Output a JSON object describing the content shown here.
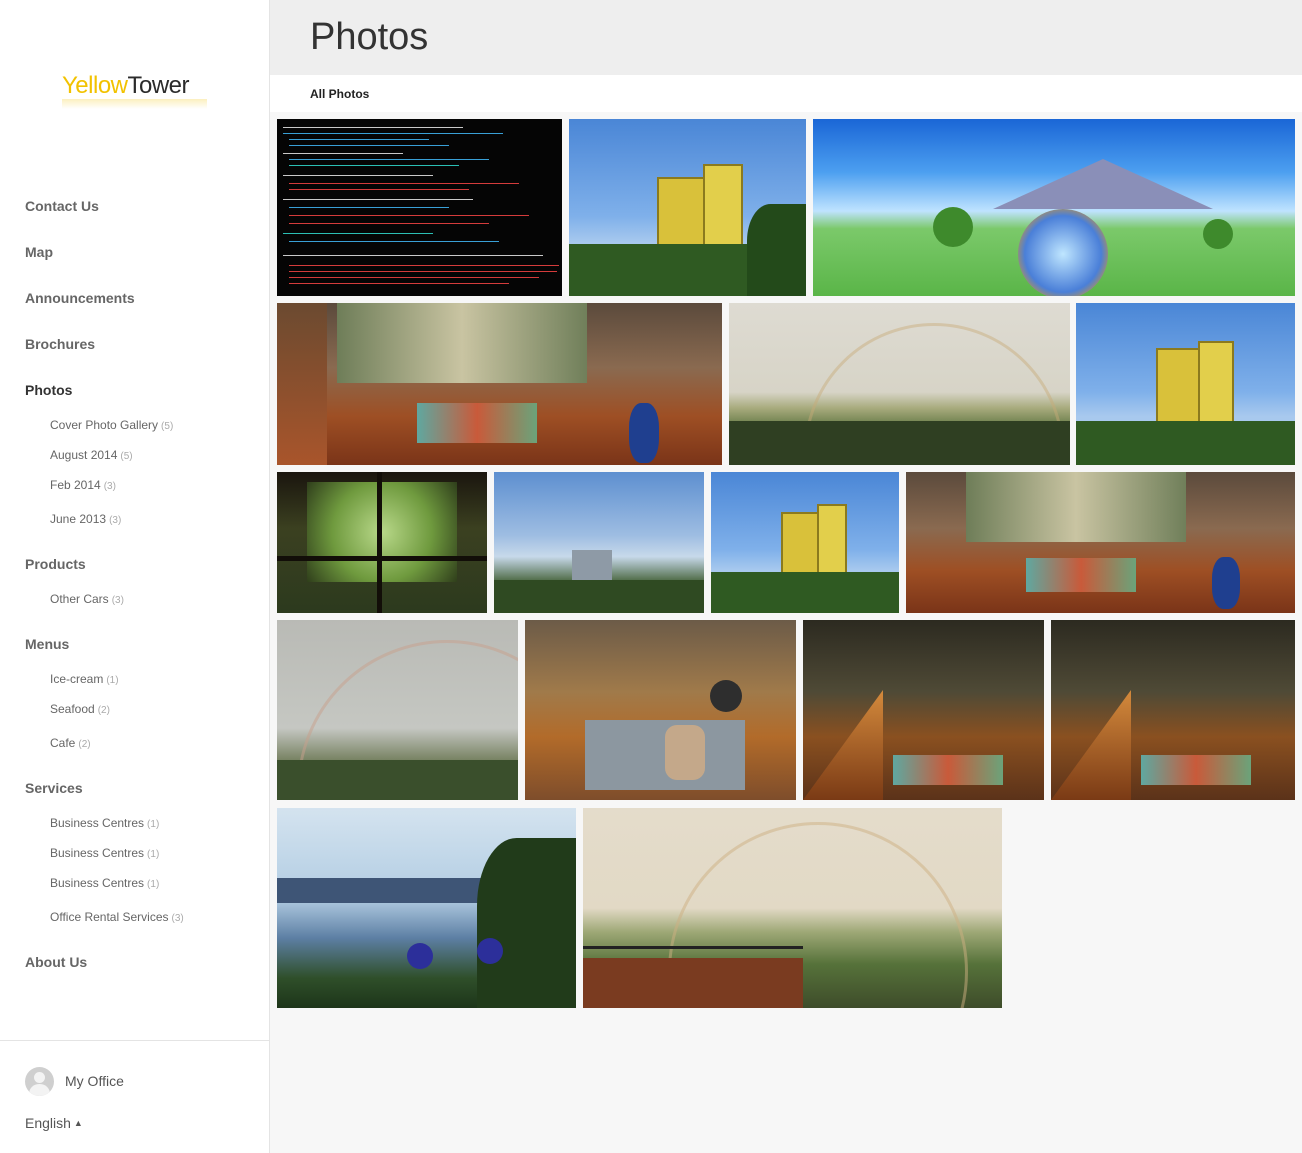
{
  "brand": {
    "logo_part1": "Yellow",
    "logo_part2": "Tower"
  },
  "page": {
    "title": "Photos"
  },
  "tabs": [
    {
      "label": "All Photos",
      "active": true
    }
  ],
  "nav": [
    {
      "label": "Contact Us"
    },
    {
      "label": "Map"
    },
    {
      "label": "Announcements"
    },
    {
      "label": "Brochures"
    },
    {
      "label": "Photos",
      "active": true,
      "children": [
        {
          "label": "Cover Photo Gallery",
          "count": "(5)"
        },
        {
          "label": "August 2014",
          "count": "(5)"
        },
        {
          "label": "Feb 2014",
          "count": "(3)"
        },
        {
          "label": "June 2013",
          "count": "(3)"
        }
      ]
    },
    {
      "label": "Products",
      "children": [
        {
          "label": "Other Cars",
          "count": "(3)"
        }
      ]
    },
    {
      "label": "Menus",
      "children": [
        {
          "label": "Ice-cream",
          "count": "(1)"
        },
        {
          "label": "Seafood",
          "count": "(2)"
        },
        {
          "label": "Cafe",
          "count": "(2)"
        }
      ]
    },
    {
      "label": "Services",
      "children": [
        {
          "label": "Business Centres",
          "count": "(1)"
        },
        {
          "label": "Business Centres",
          "count": "(1)"
        },
        {
          "label": "Business Centres",
          "count": "(1)"
        },
        {
          "label": "Office Rental Services",
          "count": "(3)"
        }
      ]
    },
    {
      "label": "About Us"
    }
  ],
  "footer": {
    "office_label": "My Office",
    "language": "English",
    "language_icon": "caret-up-icon"
  },
  "photos": [
    "terminal-screenshot",
    "yellow-tower-building",
    "fantasy-landscape",
    "loft-interior",
    "rainbow-over-city",
    "yellow-tower-building",
    "window-vines",
    "city-skyline",
    "yellow-tower-building",
    "loft-interior",
    "rainbow-over-river",
    "lobby-interior",
    "loft-staircase-evening",
    "loft-staircase-evening",
    "river-view-flowers",
    "rainbow-panorama-balcony"
  ],
  "colors": {
    "accent_logo": "#f2c200",
    "sidebar_bg": "#ffffff",
    "header_bg": "#eeeeee"
  }
}
